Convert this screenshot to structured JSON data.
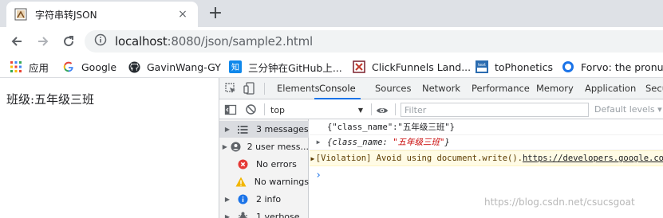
{
  "tab": {
    "title": "字符串转JSON",
    "close": "×",
    "new_tab": "+"
  },
  "address": {
    "host": "localhost",
    "rest": ":8080/json/sample2.html"
  },
  "bookmarks": [
    {
      "label": "应用",
      "icon": "apps-grid-icon"
    },
    {
      "label": "Google",
      "icon": "google-icon"
    },
    {
      "label": "GavinWang-GY",
      "icon": "github-icon"
    },
    {
      "label": "三分钟在GitHub上...",
      "icon": "zhihu-icon"
    },
    {
      "label": "ClickFunnels Land...",
      "icon": "clickfunnels-icon"
    },
    {
      "label": "toPhonetics",
      "icon": "tophonetics-icon"
    },
    {
      "label": "Forvo: the pronun",
      "icon": "forvo-icon"
    }
  ],
  "page": {
    "class_text": "班级:五年级三班"
  },
  "devtools": {
    "tabs": [
      "Elements",
      "Console",
      "Sources",
      "Network",
      "Performance",
      "Memory",
      "Application",
      "Secu"
    ],
    "active_tab": "Console",
    "context": "top",
    "filter_placeholder": "Filter",
    "levels": "Default levels ▾",
    "sidebar": [
      {
        "label": "3 messages",
        "icon": "list-icon",
        "expandable": true,
        "selected": true
      },
      {
        "label": "2 user mess...",
        "icon": "user-icon",
        "expandable": true,
        "selected": false
      },
      {
        "label": "No errors",
        "icon": "error-icon",
        "expandable": false,
        "selected": false
      },
      {
        "label": "No warnings",
        "icon": "warning-icon",
        "expandable": false,
        "selected": false
      },
      {
        "label": "2 info",
        "icon": "info-icon",
        "expandable": true,
        "selected": false
      },
      {
        "label": "1 verbose",
        "icon": "bug-icon",
        "expandable": true,
        "selected": false
      }
    ],
    "console": {
      "line1": "{\"class_name\":\"五年级三班\"}",
      "line2_key": "{class_name: ",
      "line2_val": "\"五年级三班\"",
      "line2_end": "}",
      "line3_text": "[Violation] Avoid using document.write(). ",
      "line3_link": "https://developers.google.co",
      "prompt": "›"
    }
  },
  "watermark": "https://blog.csdn.net/csucsgoat",
  "colors": {
    "accent": "#1a73e8",
    "string_red": "#c80000",
    "warn_bg": "#fffbe5"
  }
}
